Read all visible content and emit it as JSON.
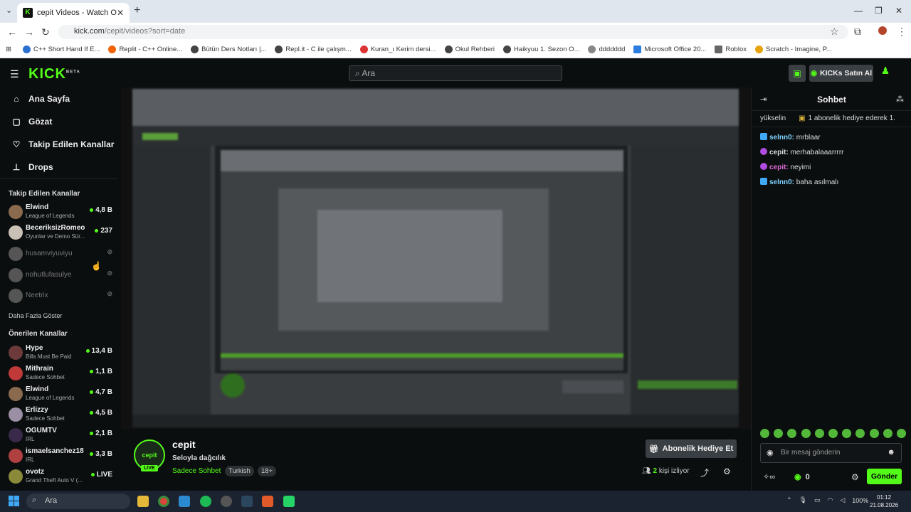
{
  "browser": {
    "tab_title": "cepit Videos - Watch On-Dema",
    "url_host": "kick.com",
    "url_path": "/cepit/videos?sort=date",
    "bookmarks": [
      "C++ Short Hand If E...",
      "Replit - C++ Online...",
      "Bütün Ders Notları |...",
      "Repl.it - C ile çalışm...",
      "Kuran_ı Kerim dersi...",
      "Okul Rehberi",
      "Haikyuu 1. Sezon O...",
      "ddddddd",
      "Microsoft Office 20...",
      "Roblox",
      "Scratch - Imagine, P..."
    ]
  },
  "header": {
    "logo": "KICK",
    "logo_beta": "BETA",
    "search_placeholder": "Ara",
    "buy_kicks": "KICKs Satın Al"
  },
  "sidebar": {
    "nav": [
      {
        "label": "Ana Sayfa",
        "icon": "home-icon"
      },
      {
        "label": "Gözat",
        "icon": "browse-icon"
      },
      {
        "label": "Takip Edilen Kanallar",
        "icon": "heart-icon"
      },
      {
        "label": "Drops",
        "icon": "drops-icon"
      }
    ],
    "followed_title": "Takip Edilen Kanallar",
    "followed": [
      {
        "name": "Elwind",
        "category": "League of Legends",
        "viewers": "4,8 B",
        "live": true
      },
      {
        "name": "BeceriksizRomeo",
        "category": "Oyunlar ve Demo Sür...",
        "viewers": "237",
        "live": true
      },
      {
        "name": "husamviyuviyu",
        "category": "",
        "viewers": "",
        "live": false
      },
      {
        "name": "nohutlufasulye",
        "category": "",
        "viewers": "",
        "live": false
      },
      {
        "name": "Neetrix",
        "category": "",
        "viewers": "",
        "live": false
      }
    ],
    "show_more": "Daha Fazla Göster",
    "recommended_title": "Önerilen Kanallar",
    "recommended": [
      {
        "name": "Hype",
        "category": "Bills Must Be Paid",
        "viewers": "13,4 B"
      },
      {
        "name": "Mithrain",
        "category": "Sadece Sohbet",
        "viewers": "1,1 B"
      },
      {
        "name": "Elwind",
        "category": "League of Legends",
        "viewers": "4,7 B"
      },
      {
        "name": "Erlizzy",
        "category": "Sadece Sohbet",
        "viewers": "4,5 B"
      },
      {
        "name": "OGUMTV",
        "category": "IRL",
        "viewers": "2,1 B"
      },
      {
        "name": "ismaelsanchez18",
        "category": "IRL",
        "viewers": "3,3 B"
      },
      {
        "name": "ovotz",
        "category": "Grand Theft Auto V (...",
        "viewers": "LIVE"
      }
    ]
  },
  "stream": {
    "avatar_text": "cepit",
    "live": "LIVE",
    "name": "cepit",
    "title": "Seloyla dağcılık",
    "category": "Sadece Sohbet",
    "tags": [
      "Turkish",
      "18+"
    ],
    "sub_gift_button": "Abonelik Hediye Et",
    "viewer_count": "2",
    "viewer_label": "kişi izliyor"
  },
  "chat": {
    "title": "Sohbet",
    "pinned_user": "yükselin",
    "pinned_text": "1 abonelik hediye ederek 1.",
    "messages": [
      {
        "user": "selnn0:",
        "text": "mrblaar",
        "color": "#7fd3ff",
        "icon_color": "#3fa9f5"
      },
      {
        "user": "cepit:",
        "text": "merhabalaaarrrrr",
        "color": "#ddd",
        "icon_color": "#b04ce0"
      },
      {
        "user": "cepit:",
        "text": "neyimi",
        "color": "#e06ad8",
        "icon_color": "#b04ce0"
      },
      {
        "user": "selnn0:",
        "text": "baha asılmalı",
        "color": "#7fd3ff",
        "icon_color": "#3fa9f5"
      }
    ],
    "input_placeholder": "Bir mesaj gönderin",
    "points": "0",
    "send": "Gönder"
  },
  "taskbar": {
    "search": "Ara",
    "battery": "100%",
    "time": "01:12",
    "date": "21.08.2026"
  }
}
